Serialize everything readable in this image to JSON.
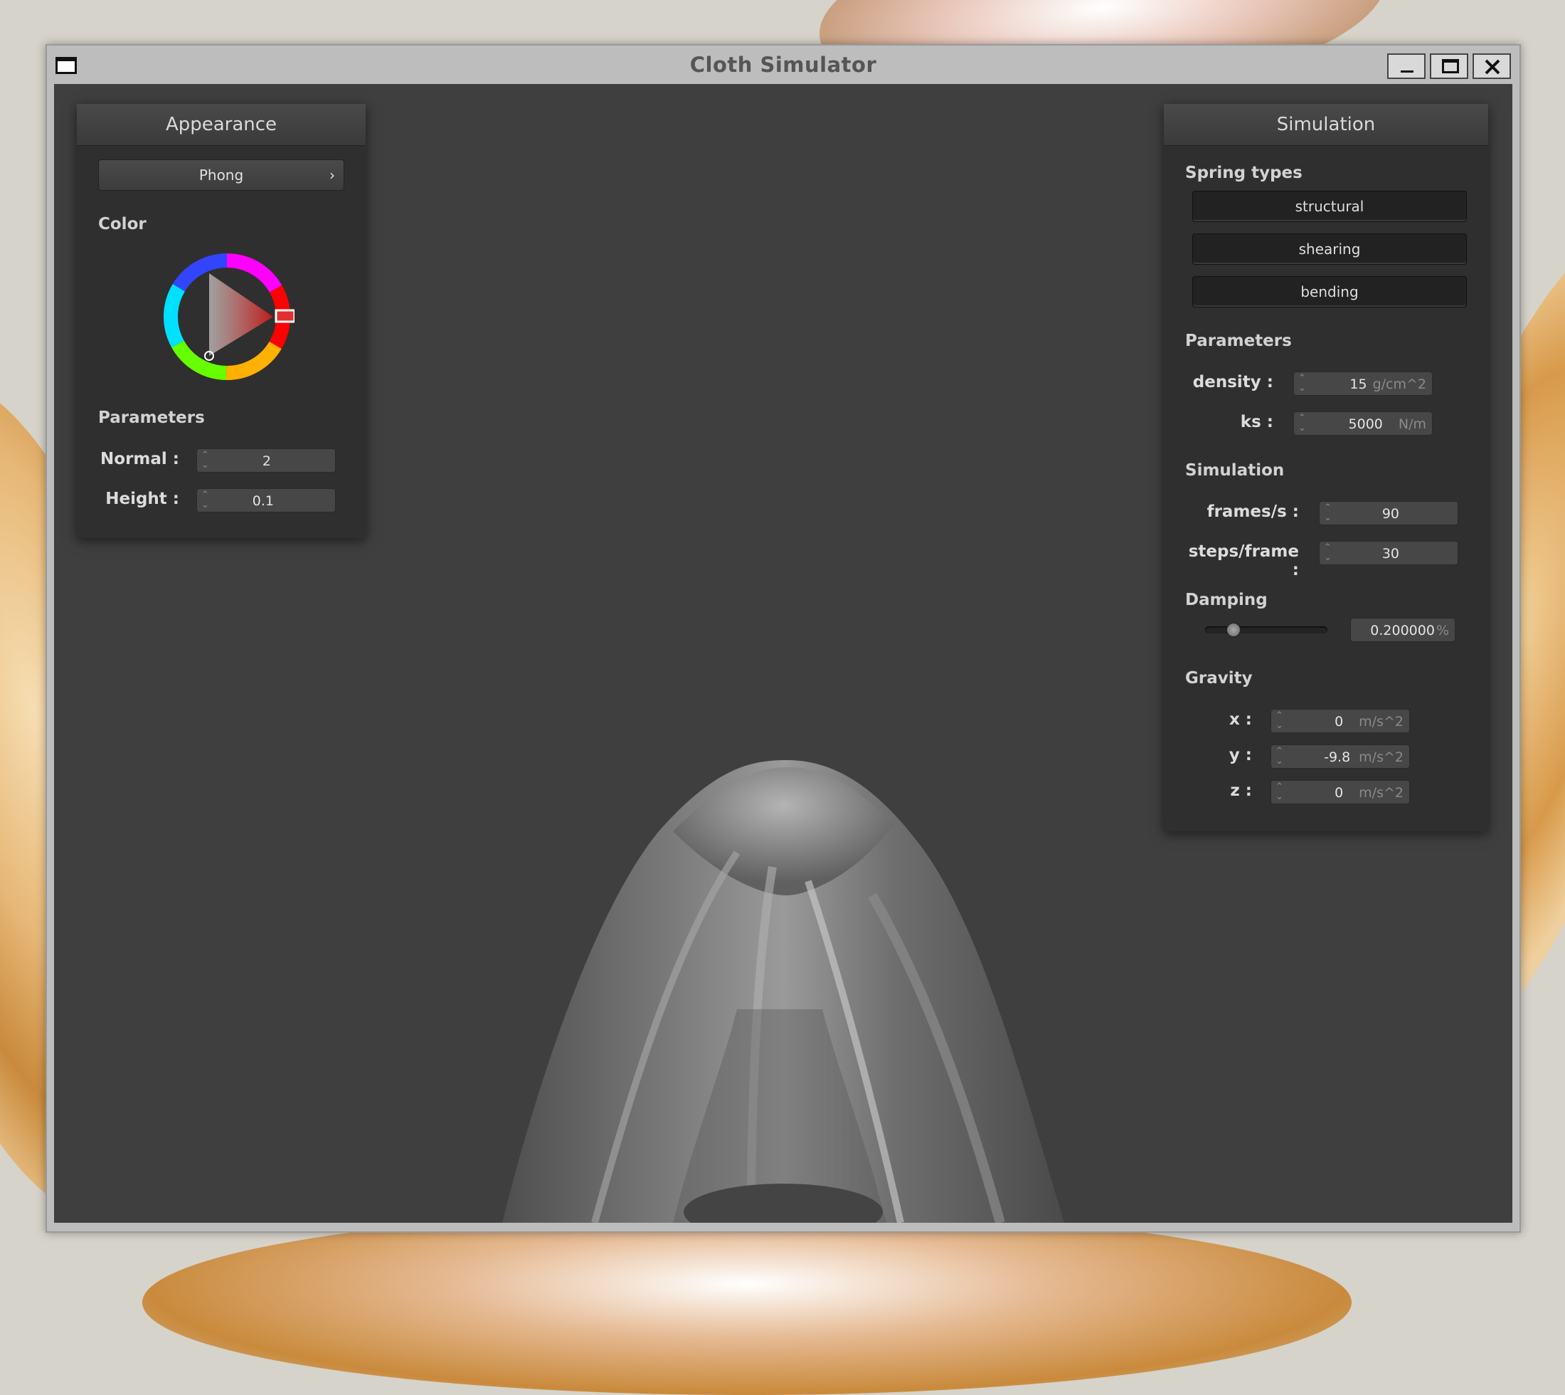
{
  "window": {
    "title": "Cloth Simulator"
  },
  "appearance": {
    "header": "Appearance",
    "shader": "Phong",
    "color_label": "Color",
    "parameters_label": "Parameters",
    "normal_label": "Normal :",
    "normal_value": "2",
    "height_label": "Height :",
    "height_value": "0.1",
    "selected_color": "#ff3333"
  },
  "simulation": {
    "header": "Simulation",
    "spring_types_label": "Spring types",
    "springs": [
      "structural",
      "shearing",
      "bending"
    ],
    "parameters_label": "Parameters",
    "density_label": "density :",
    "density_value": "15",
    "density_unit": "g/cm^2",
    "ks_label": "ks :",
    "ks_value": "5000",
    "ks_unit": "N/m",
    "simulation_label": "Simulation",
    "fps_label": "frames/s :",
    "fps_value": "90",
    "steps_label": "steps/frame :",
    "steps_value": "30",
    "damping_label": "Damping",
    "damping_value": "0.200000",
    "damping_unit": "%",
    "damping_level": 0.2,
    "gravity_label": "Gravity",
    "gx_label": "x :",
    "gx_value": "0",
    "gy_label": "y :",
    "gy_value": "-9.8",
    "gz_label": "z :",
    "gz_value": "0",
    "gravity_unit": "m/s^2"
  }
}
